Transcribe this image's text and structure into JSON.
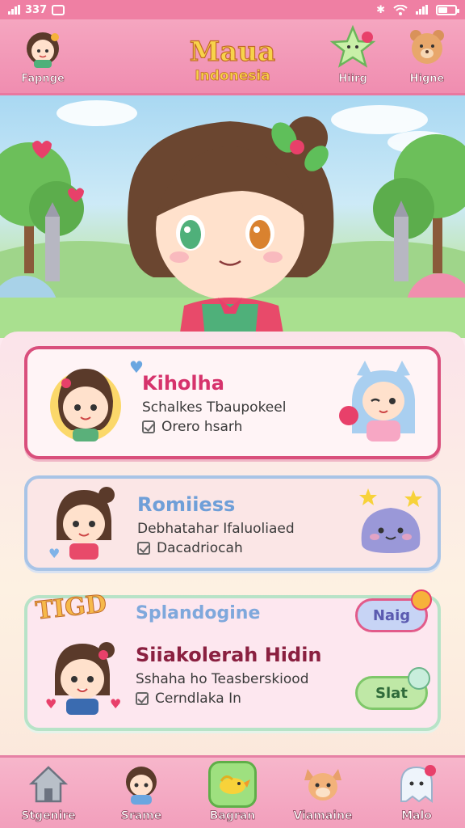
{
  "status_bar": {
    "time": "337"
  },
  "header": {
    "title": "Maua",
    "subtitle": "Indonesia",
    "left_label": "Fapnge",
    "right_items": [
      {
        "label": "Hiirg",
        "icon": "star-icon"
      },
      {
        "label": "Higne",
        "icon": "bear-icon"
      }
    ]
  },
  "cards": [
    {
      "title": "Kiholha",
      "subtitle": "Schalkes Tbaupokeel",
      "meta": "Orero hsarh",
      "title_color": "#d6336c"
    },
    {
      "title": "Romiiess",
      "subtitle": "Debhatahar Ifaluoliaed",
      "meta": "Dacadriocah",
      "title_color": "#6f9fd8"
    },
    {
      "title": "Siiakolerah Hidin",
      "heading": "Splandogine",
      "subtitle": "Sshaha ho Teasberskiood",
      "meta": "Cerndlaka In",
      "title_color": "#8a2040"
    }
  ],
  "splash_text": "TIGD",
  "buttons": {
    "blue": "Naig",
    "green": "Slat"
  },
  "bottom_nav": [
    {
      "label": "Stgenire",
      "icon": "home-icon"
    },
    {
      "label": "Srame",
      "icon": "character-icon"
    },
    {
      "label": "Bagran",
      "icon": "bird-icon",
      "active": true
    },
    {
      "label": "Viamaine",
      "icon": "fox-icon"
    },
    {
      "label": "Malo",
      "icon": "ghost-icon"
    }
  ]
}
